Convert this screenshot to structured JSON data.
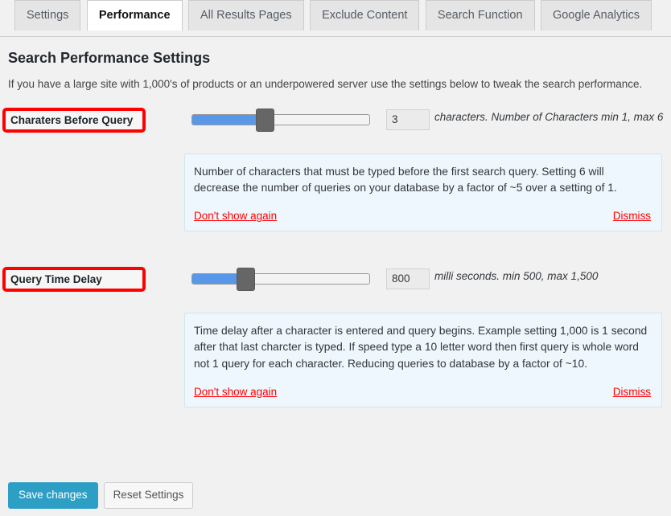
{
  "tabs": [
    {
      "label": "Settings",
      "active": false
    },
    {
      "label": "Performance",
      "active": true
    },
    {
      "label": "All Results Pages",
      "active": false
    },
    {
      "label": "Exclude Content",
      "active": false
    },
    {
      "label": "Search Function",
      "active": false
    },
    {
      "label": "Google Analytics",
      "active": false
    }
  ],
  "page": {
    "heading": "Search Performance Settings",
    "intro": "If you have a large site with 1,000's of products or an underpowered server use the settings below to tweak the search performance."
  },
  "settings": [
    {
      "label": "Charaters Before Query",
      "value": "3",
      "unit": "characters. Number of Characters min 1, max 6",
      "slider": {
        "min": 1,
        "max": 6,
        "current": 3,
        "fill_percent": 40,
        "handle_percent": 36
      },
      "notice": {
        "text": "Number of characters that must be typed before the first search query. Setting 6 will decrease the number of queries on your database by a factor of ~5 over a setting of 1.",
        "dont_show_again": "Don't show again",
        "dismiss": "Dismiss"
      }
    },
    {
      "label": "Query Time Delay",
      "value": "800",
      "unit": "milli seconds. min 500, max 1,500",
      "slider": {
        "min": 500,
        "max": 1500,
        "current": 800,
        "fill_percent": 29,
        "handle_percent": 25
      },
      "notice": {
        "text": "Time delay after a character is entered and query begins. Example setting 1,000 is 1 second after that last charcter is typed. If speed type a 10 letter word then first query is whole word not 1 query for each character. Reducing queries to database by a factor of ~10.",
        "dont_show_again": "Don't show again",
        "dismiss": "Dismiss"
      }
    }
  ],
  "footer": {
    "save_label": "Save changes",
    "reset_label": "Reset Settings"
  },
  "colors": {
    "accent_blue": "#5997e8",
    "primary_button": "#2d9fc4",
    "highlight_outline": "#ff0000",
    "notice_background": "#eef7fd",
    "link_red": "#ff0000"
  }
}
